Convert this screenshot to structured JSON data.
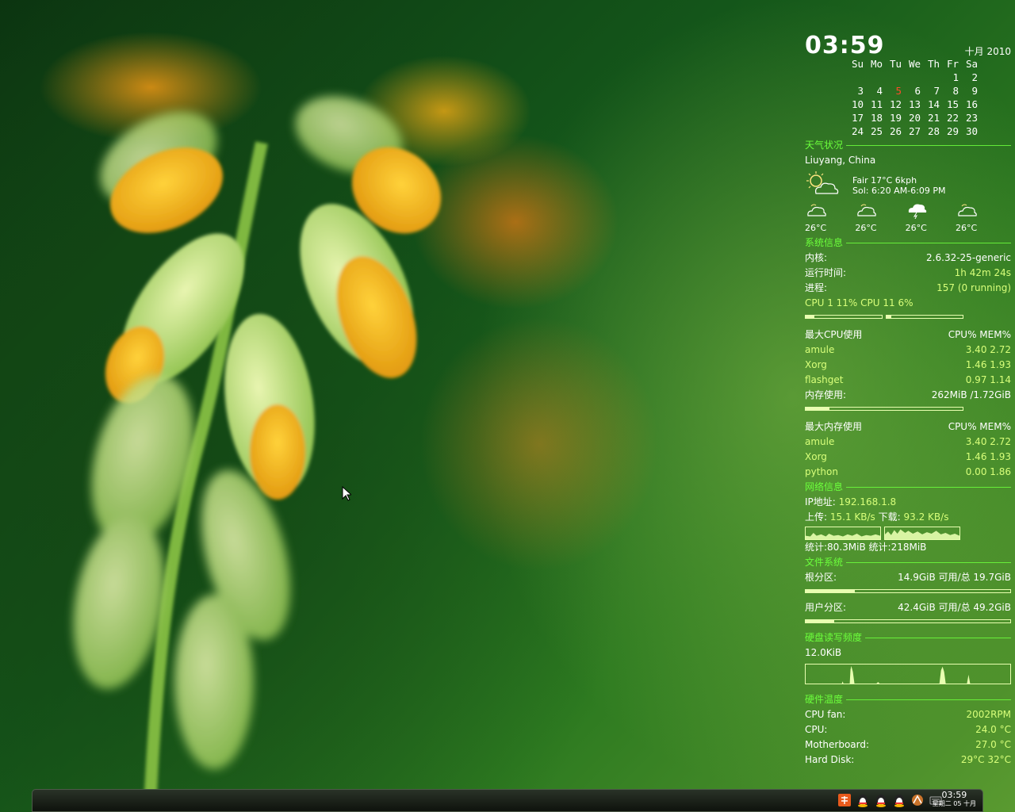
{
  "clock": {
    "time": "03:59",
    "month_year": "十月 2010"
  },
  "calendar": {
    "weekdays": [
      "Su",
      "Mo",
      "Tu",
      "We",
      "Th",
      "Fr",
      "Sa"
    ],
    "weeks": [
      [
        "",
        "",
        "",
        "",
        "",
        "1",
        "2"
      ],
      [
        "3",
        "4",
        "5",
        "6",
        "7",
        "8",
        "9"
      ],
      [
        "10",
        "11",
        "12",
        "13",
        "14",
        "15",
        "16"
      ],
      [
        "17",
        "18",
        "19",
        "20",
        "21",
        "22",
        "23"
      ],
      [
        "24",
        "25",
        "26",
        "27",
        "28",
        "29",
        "30"
      ]
    ],
    "today": "5"
  },
  "weather": {
    "heading": "天气状况",
    "location": "Liuyang, China",
    "now_line1": "Fair  17°C  6kph",
    "now_line2": "Sol: 6:20 AM-6:09 PM",
    "forecast": [
      {
        "temp": "26°C",
        "icon": "partly-cloudy-icon"
      },
      {
        "temp": "26°C",
        "icon": "partly-cloudy-icon"
      },
      {
        "temp": "26°C",
        "icon": "storm-cloud-icon"
      },
      {
        "temp": "26°C",
        "icon": "partly-cloudy-icon"
      }
    ]
  },
  "system": {
    "heading": "系统信息",
    "kernel_label": "内核:",
    "kernel": "2.6.32-25-generic",
    "uptime_label": "运行时间:",
    "uptime": "1h 42m 24s",
    "proc_label": "进程:",
    "proc": "157 (0 running)",
    "cpu_line": "CPU 1 11% CPU 11 6%",
    "cpu1_percent": 11,
    "cpu2_percent": 6
  },
  "top_cpu": {
    "heading": "最大CPU使用",
    "cols": "CPU% MEM%",
    "rows": [
      {
        "name": "amule",
        "vals": "3.40  2.72"
      },
      {
        "name": "Xorg",
        "vals": "1.46  1.93"
      },
      {
        "name": "flashget",
        "vals": "0.97  1.14"
      }
    ],
    "mem_label": "内存使用:",
    "mem": "262MiB /1.72GiB",
    "mem_fraction": 0.15
  },
  "top_mem": {
    "heading": "最大内存使用",
    "cols": "CPU% MEM%",
    "rows": [
      {
        "name": "amule",
        "vals": "3.40  2.72"
      },
      {
        "name": "Xorg",
        "vals": "1.46  1.93"
      },
      {
        "name": "python",
        "vals": "0.00  1.86"
      }
    ]
  },
  "network": {
    "heading": "网络信息",
    "ip_label": "IP地址:",
    "ip": "192.168.1.8",
    "up_label": "上传:",
    "up": "15.1 KB/s",
    "down_label": "下载:",
    "down": "93.2 KB/s",
    "total_up_label": "统计:",
    "total_up": "80.3MiB",
    "total_down_label": "统计:",
    "total_down": "218MiB"
  },
  "filesystem": {
    "heading": "文件系统",
    "root_label": "根分区:",
    "root": "14.9GiB 可用/总 19.7GiB",
    "root_used_fraction": 0.24,
    "home_label": "用户分区:",
    "home": "42.4GiB 可用/总 49.2GiB",
    "home_used_fraction": 0.14
  },
  "disk_io": {
    "heading": "硬盘读写频度",
    "value": "12.0KiB"
  },
  "hardware": {
    "heading": "硬件温度",
    "rows": [
      {
        "label": "CPU fan:",
        "value": "2002RPM"
      },
      {
        "label": "CPU:",
        "value": "24.0 °C"
      },
      {
        "label": "Motherboard:",
        "value": "27.0 °C"
      },
      {
        "label": "Hard Disk:",
        "value": "29°C  32°C"
      }
    ]
  },
  "taskbar": {
    "time": "03:59",
    "date": "星期二 05 十月"
  },
  "colors": {
    "accent": "#6cff3c",
    "value": "#d8ff7a",
    "today": "#ff4a2a"
  }
}
